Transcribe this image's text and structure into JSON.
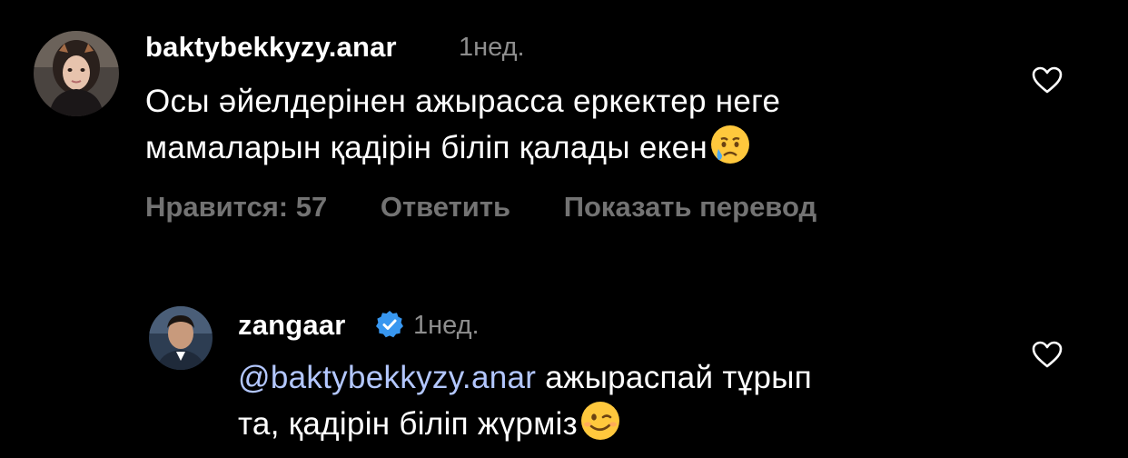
{
  "comments": [
    {
      "username": "baktybekkyzy.anar",
      "time": "1нед.",
      "text_line1": "Осы әйелдерінен ажырасса еркектер неге",
      "text_line2": "мамаларын қадірін біліп қалады екен",
      "emoji": "crying-face",
      "likes_label": "Нравится: 57",
      "reply_label": "Ответить",
      "translate_label": "Показать перевод"
    },
    {
      "username": "zangaar",
      "verified": true,
      "time": "1нед.",
      "mention": "@baktybekkyzy.anar",
      "text_line1_rest": " ажыраспай тұрып",
      "text_line2": "та, қадірін біліп жүрміз",
      "emoji": "winking-face"
    }
  ],
  "colors": {
    "background": "#000000",
    "text": "#ffffff",
    "secondary": "#737373",
    "mention": "#b3c7ff",
    "verified": "#3897f0"
  }
}
